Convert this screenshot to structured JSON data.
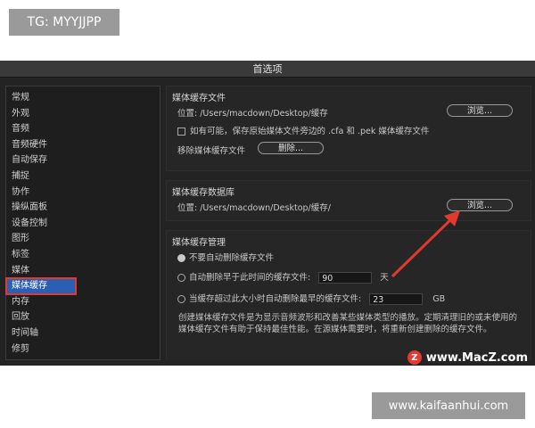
{
  "overlay_top": "TG: MYYJJPP",
  "overlay_bottom": "www.kaifaanhui.com",
  "watermark": {
    "logo_letter": "Z",
    "text": "www.MacZ.com"
  },
  "window": {
    "title": "首选项"
  },
  "sidebar": {
    "items": [
      {
        "label": "常规"
      },
      {
        "label": "外观"
      },
      {
        "label": "音频"
      },
      {
        "label": "音频硬件"
      },
      {
        "label": "自动保存"
      },
      {
        "label": "捕捉"
      },
      {
        "label": "协作"
      },
      {
        "label": "操纵面板"
      },
      {
        "label": "设备控制"
      },
      {
        "label": "图形"
      },
      {
        "label": "标签"
      },
      {
        "label": "媒体"
      },
      {
        "label": "媒体缓存"
      },
      {
        "label": "内存"
      },
      {
        "label": "回放"
      },
      {
        "label": "时间轴"
      },
      {
        "label": "修剪"
      }
    ],
    "selected": "媒体缓存"
  },
  "cache_files": {
    "title": "媒体缓存文件",
    "location": "位置:  /Users/macdown/Desktop/缓存",
    "browse": "浏览...",
    "checkbox_label": "如有可能，保存原始媒体文件旁边的 .cfa 和 .pek 媒体缓存文件",
    "remove_label": "移除媒体缓存文件",
    "delete": "删除..."
  },
  "cache_db": {
    "title": "媒体缓存数据库",
    "location": "位置:  /Users/macdown/Desktop/缓存/",
    "browse": "浏览..."
  },
  "cache_mgmt": {
    "title": "媒体缓存管理",
    "opt_none": "不要自动删除缓存文件",
    "opt_older": "自动删除早于此时间的缓存文件:",
    "older_value": "90",
    "older_unit": "天",
    "opt_size": "当缓存超过此大小时自动删除最早的缓存文件:",
    "size_value": "23",
    "size_unit": "GB",
    "desc": "创建媒体缓存文件是为显示音频波形和改善某些媒体类型的播放。定期清理旧的或未使用的媒体缓存文件有助于保持最佳性能。在源媒体需要时，将重新创建删除的缓存文件。"
  },
  "colors": {
    "accent": "#2b5fb4",
    "highlight_red": "#e03a2f"
  }
}
